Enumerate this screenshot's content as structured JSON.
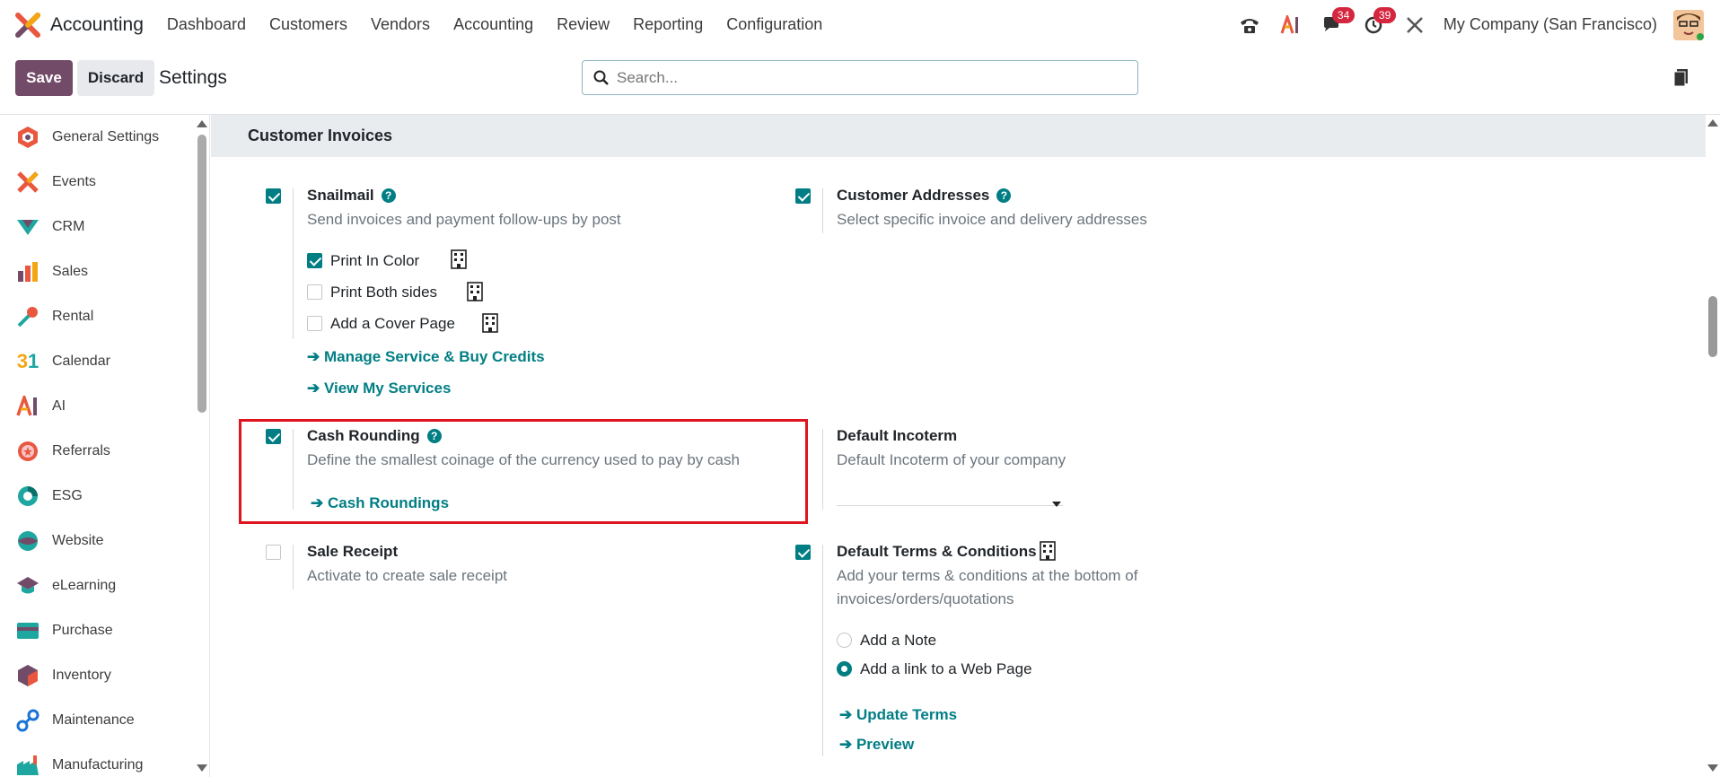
{
  "app": {
    "name": "Accounting"
  },
  "menu": [
    "Dashboard",
    "Customers",
    "Vendors",
    "Accounting",
    "Review",
    "Reporting",
    "Configuration"
  ],
  "systray": {
    "messages_count": "34",
    "activities_count": "39",
    "company": "My Company (San Francisco)"
  },
  "control": {
    "save_label": "Save",
    "discard_label": "Discard",
    "title": "Settings",
    "search_placeholder": "Search..."
  },
  "sidebar": {
    "items": [
      {
        "label": "General Settings",
        "icon": "general-settings-icon"
      },
      {
        "label": "Events",
        "icon": "events-icon"
      },
      {
        "label": "CRM",
        "icon": "crm-icon"
      },
      {
        "label": "Sales",
        "icon": "sales-icon"
      },
      {
        "label": "Rental",
        "icon": "rental-icon"
      },
      {
        "label": "Calendar",
        "icon": "calendar-icon"
      },
      {
        "label": "AI",
        "icon": "ai-icon"
      },
      {
        "label": "Referrals",
        "icon": "referrals-icon"
      },
      {
        "label": "ESG",
        "icon": "esg-icon"
      },
      {
        "label": "Website",
        "icon": "website-icon"
      },
      {
        "label": "eLearning",
        "icon": "elearning-icon"
      },
      {
        "label": "Purchase",
        "icon": "purchase-icon"
      },
      {
        "label": "Inventory",
        "icon": "inventory-icon"
      },
      {
        "label": "Maintenance",
        "icon": "maintenance-icon"
      },
      {
        "label": "Manufacturing",
        "icon": "manufacturing-icon"
      }
    ]
  },
  "section": {
    "title": "Customer Invoices"
  },
  "settings": {
    "snailmail": {
      "title": "Snailmail",
      "desc": "Send invoices and payment follow-ups by post",
      "checked": true,
      "options": [
        {
          "label": "Print In Color",
          "checked": true
        },
        {
          "label": "Print Both sides",
          "checked": false
        },
        {
          "label": "Add a Cover Page",
          "checked": false
        }
      ],
      "links": [
        "Manage Service & Buy Credits",
        "View My Services"
      ]
    },
    "customer_addresses": {
      "title": "Customer Addresses",
      "desc": "Select specific invoice and delivery addresses",
      "checked": true
    },
    "cash_rounding": {
      "title": "Cash Rounding",
      "desc": "Define the smallest coinage of the currency used to pay by cash",
      "link": "Cash Roundings",
      "checked": true
    },
    "default_incoterm": {
      "title": "Default Incoterm",
      "desc": "Default Incoterm of your company"
    },
    "sale_receipt": {
      "title": "Sale Receipt",
      "desc": "Activate to create sale receipt",
      "checked": false
    },
    "default_terms": {
      "title": "Default Terms & Conditions",
      "desc_line1": "Add your terms & conditions at the bottom of",
      "desc_line2": "invoices/orders/quotations",
      "checked": true,
      "radios": [
        {
          "label": "Add a Note",
          "selected": false
        },
        {
          "label": "Add a link to a Web Page",
          "selected": true
        }
      ],
      "links": [
        "Update Terms",
        "Preview"
      ]
    }
  },
  "colors": {
    "brand": "#714b67",
    "accent": "#017e84",
    "highlight": "#e0141e"
  }
}
